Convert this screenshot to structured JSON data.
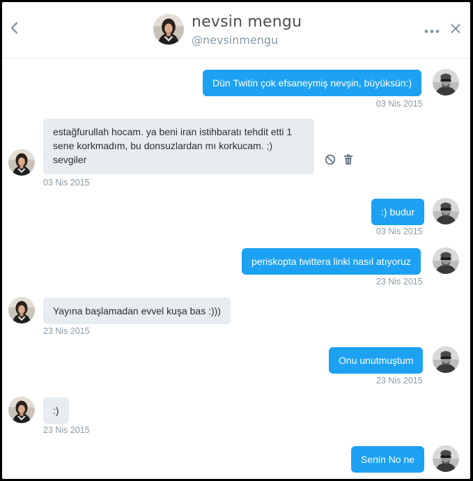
{
  "header": {
    "name": "nevsin mengu",
    "handle": "@nevsinmengu"
  },
  "colors": {
    "accent": "#1da1f2",
    "incoming_bg": "#e6ecf0",
    "timestamp": "#8899a6"
  },
  "icons": {
    "back": "chevron-left-icon",
    "more": "more-dots-icon",
    "close": "close-icon",
    "block": "block-icon",
    "delete": "trash-icon"
  },
  "messages": [
    {
      "direction": "outgoing",
      "text": "Dün Twitin çok efsaneymiş nevşin, büyüksün:)",
      "time": "03 Nis 2015"
    },
    {
      "direction": "incoming",
      "lines": [
        "estağfurullah hocam. ya beni iran istihbaratı tehdit etti 1",
        "sene korkmadım, bu donsuzlardan mı korkucam. ;)",
        "sevgiler"
      ],
      "time": "03 Nis 2015"
    },
    {
      "direction": "outgoing",
      "text": ":) budur",
      "time": "03 Nis 2015"
    },
    {
      "direction": "outgoing",
      "text": "periskopta twittera linki nasıl atıyoruz",
      "time": "23 Nis 2015"
    },
    {
      "direction": "incoming",
      "text": "Yayına başlamadan evvel kuşa bas :)))",
      "time": "23 Nis 2015"
    },
    {
      "direction": "outgoing",
      "text": "Onu unutmuştum",
      "time": "23 Nis 2015"
    },
    {
      "direction": "incoming",
      "text": ":)",
      "time": "23 Nis 2015"
    },
    {
      "direction": "outgoing",
      "text": "Senin No ne",
      "time": ""
    }
  ]
}
